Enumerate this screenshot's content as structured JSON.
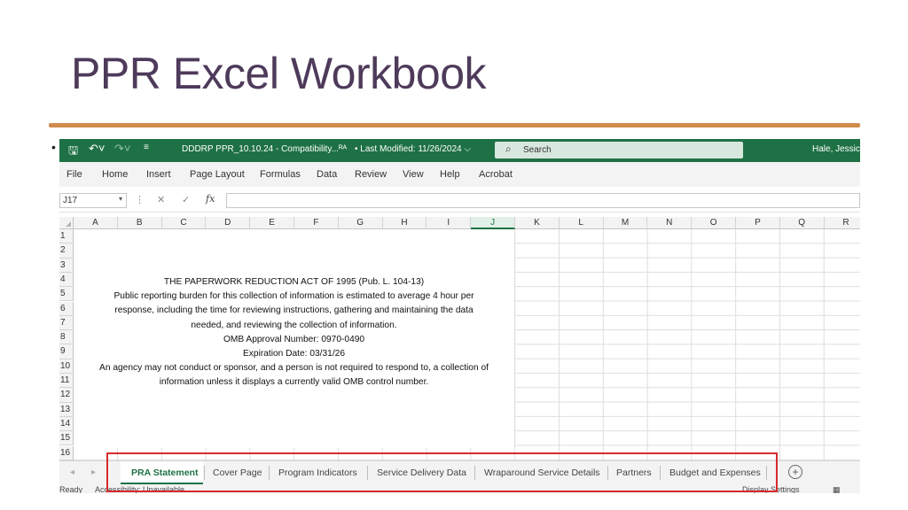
{
  "slide": {
    "title": "PPR Excel Workbook",
    "bullet": "•"
  },
  "excel": {
    "titlebar": {
      "save_icon": "save-icon",
      "undo_icon": "undo-icon",
      "redo_icon": "redo-icon",
      "customize_icon": "customize-icon",
      "filename": "DDDRP PPR_10.10.24  -  Compatibility...",
      "shared_marker": "ᴿᴬ",
      "last_modified": "• Last Modified: 11/26/2024",
      "search_placeholder": "Search",
      "user": "Hale, Jessica"
    },
    "menu": [
      "File",
      "Home",
      "Insert",
      "Page Layout",
      "Formulas",
      "Data",
      "Review",
      "View",
      "Help",
      "Acrobat"
    ],
    "formula_bar": {
      "name_box": "J17",
      "fx": "fx",
      "value": ""
    },
    "columns": [
      "A",
      "B",
      "C",
      "D",
      "E",
      "F",
      "G",
      "H",
      "I",
      "J",
      "K",
      "L",
      "M",
      "N",
      "O",
      "P",
      "Q",
      "R"
    ],
    "selected_column": "J",
    "rows": [
      "1",
      "2",
      "3",
      "4",
      "5",
      "6",
      "7",
      "8",
      "9",
      "10",
      "11",
      "12",
      "13",
      "14",
      "15",
      "16"
    ],
    "pra_text": [
      "THE PAPERWORK REDUCTION ACT OF 1995 (Pub. L. 104-13)",
      "Public reporting burden for this collection of information is estimated to average 4 hour per",
      "response, including the time for reviewing instructions, gathering and maintaining the data",
      "needed, and reviewing the collection of information.",
      "OMB Approval Number: 0970-0490",
      "Expiration Date: 03/31/26",
      "An agency may not conduct or sponsor, and a person is not required to respond to, a collection of",
      "information unless it displays a currently valid OMB control number."
    ],
    "sheet_tabs": [
      "PRA Statement",
      "Cover Page",
      "Program Indicators",
      "Service Delivery Data",
      "Wraparound Service Details",
      "Partners",
      "Budget and Expenses"
    ],
    "active_tab": "PRA Statement",
    "status": {
      "ready": "Ready",
      "accessibility": "Accessibility: Unavailable",
      "display": "Display Settings"
    },
    "highlight_color": "#d62b2b",
    "accent_color": "#1e7145"
  }
}
